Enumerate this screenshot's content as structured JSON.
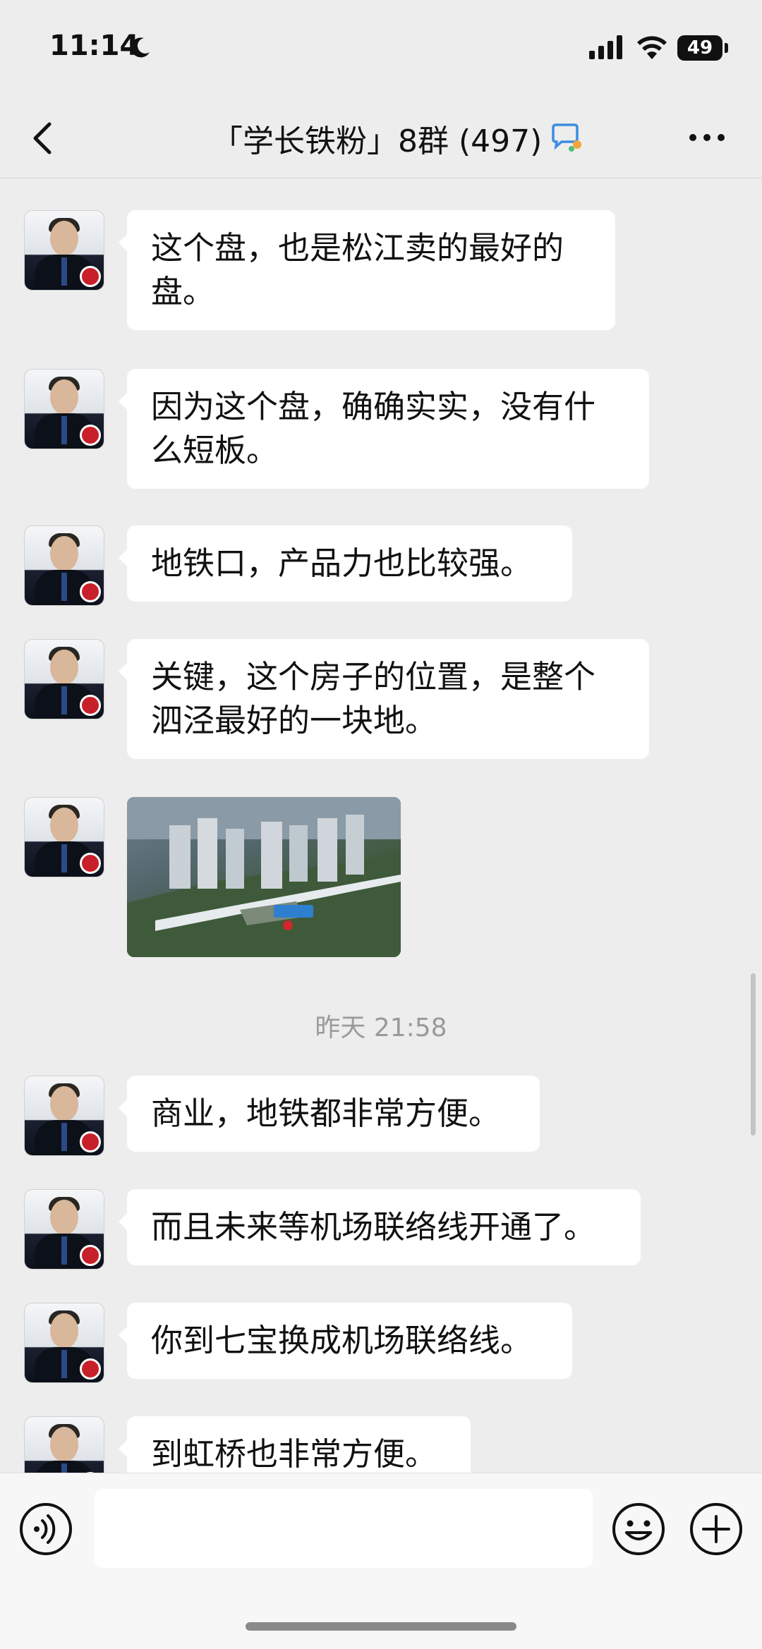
{
  "status_bar": {
    "time": "11:14",
    "battery": "49"
  },
  "header": {
    "title": "「学长铁粉」8群 (497)"
  },
  "messages": [
    {
      "type": "text",
      "text": "这个盘，也是松江卖的最好的\n盘。"
    },
    {
      "type": "text",
      "text": "因为这个盘，确确实实，没有什\n么短板。"
    },
    {
      "type": "text",
      "text": "地铁口，产品力也比较强。"
    },
    {
      "type": "text",
      "text": "关键，这个房子的位置，是整个\n泗泾最好的一块地。"
    },
    {
      "type": "image"
    },
    {
      "type": "timestamp",
      "text": "昨天 21:58"
    },
    {
      "type": "text",
      "text": "商业，地铁都非常方便。"
    },
    {
      "type": "text",
      "text": "而且未来等机场联络线开通了。"
    },
    {
      "type": "text",
      "text": "你到七宝换成机场联络线。"
    },
    {
      "type": "text",
      "text": "到虹桥也非常方便。"
    }
  ],
  "icons": {
    "back": "chevron-left-icon",
    "group_chat": "chat-bubble-icon",
    "more": "more-dots-icon",
    "voice": "voice-icon",
    "emoji": "emoji-icon",
    "plus": "plus-icon"
  },
  "colors": {
    "background": "#ededed",
    "bubble": "#ffffff",
    "timestamp": "#9a9a9a"
  }
}
